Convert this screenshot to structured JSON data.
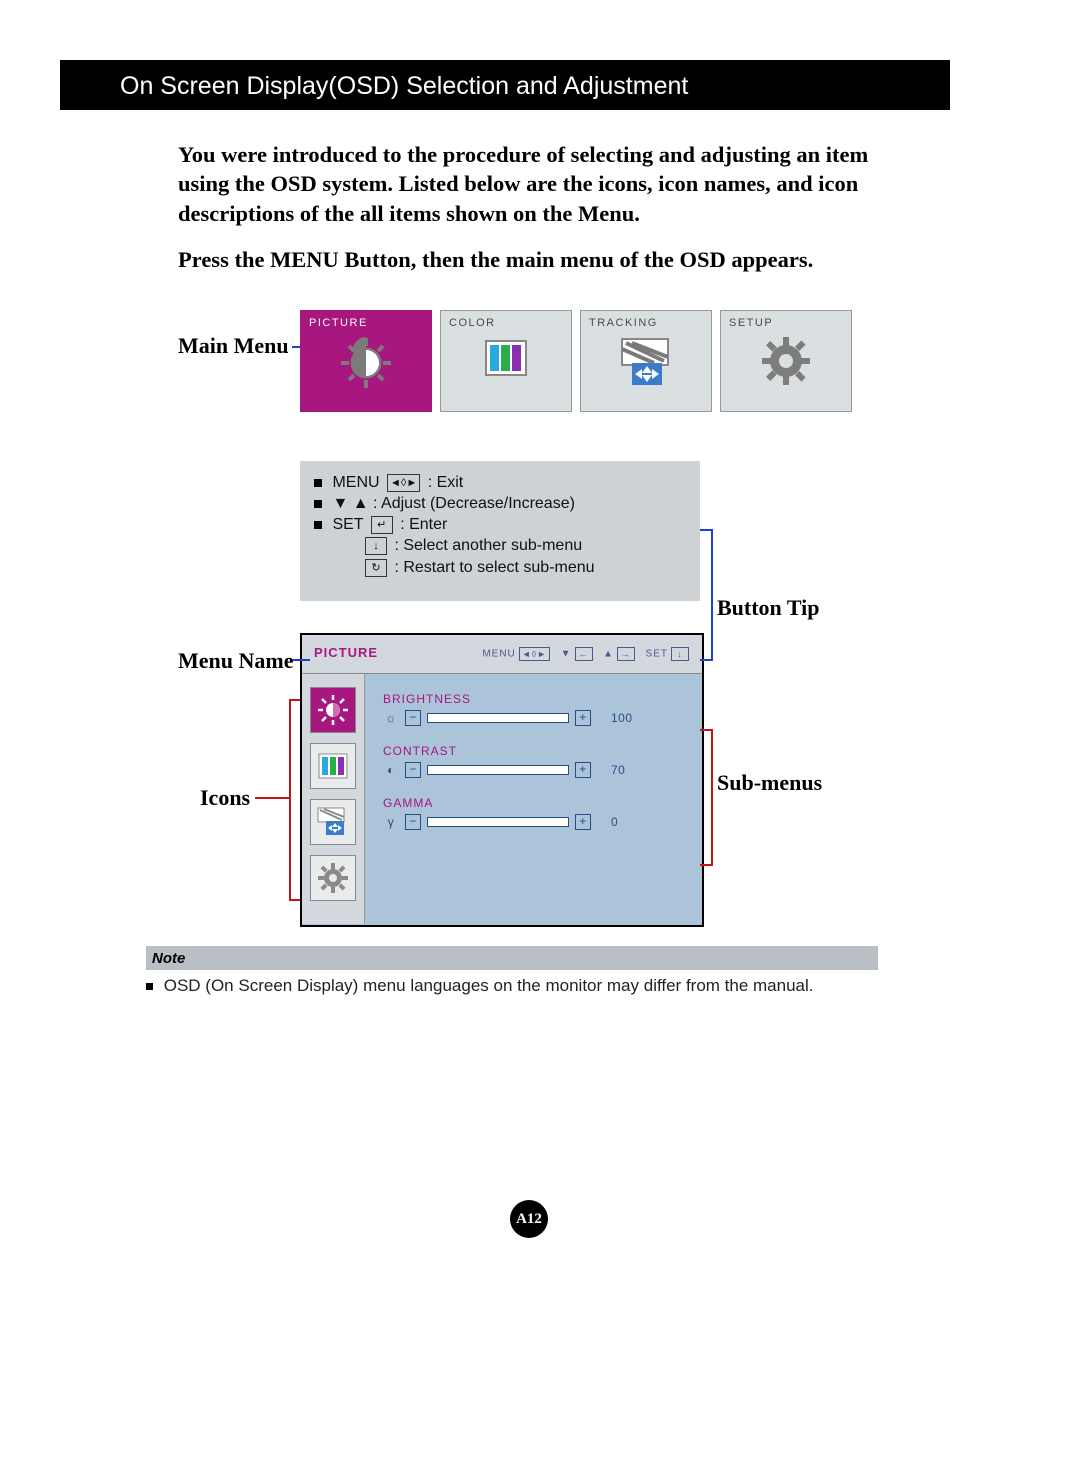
{
  "header": {
    "title": "On Screen Display(OSD) Selection and Adjustment"
  },
  "intro": "You were introduced to the procedure of selecting and adjusting an item using the OSD system.  Listed below are the icons, icon names, and icon descriptions of the all items shown on the Menu.",
  "press": "Press the MENU Button, then the main menu of the OSD appears.",
  "labels": {
    "main_menu": "Main Menu",
    "menu_name": "Menu Name",
    "icons": "Icons",
    "button_tip": "Button Tip",
    "sub_menus": "Sub-menus"
  },
  "tabs": [
    {
      "title": "PICTURE",
      "active": true,
      "icon": "brightness"
    },
    {
      "title": "COLOR",
      "active": false,
      "icon": "color"
    },
    {
      "title": "TRACKING",
      "active": false,
      "icon": "tracking"
    },
    {
      "title": "SETUP",
      "active": false,
      "icon": "gear"
    }
  ],
  "tips": {
    "menu_word": "MENU",
    "menu_key": "◄◊►",
    "menu_text": ": Exit",
    "adjust_text": ": Adjust (Decrease/Increase)",
    "set_word": "SET",
    "set_key": "↵",
    "set_text": ": Enter",
    "down_key": "↓",
    "down_text": ": Select another sub-menu",
    "cycle_key": "↻",
    "cycle_text": ": Restart to select sub-menu"
  },
  "osd": {
    "menu_name": "PICTURE",
    "hint": {
      "menu": "MENU",
      "set": "SET"
    },
    "icons": [
      {
        "name": "brightness",
        "active": true
      },
      {
        "name": "color",
        "active": false
      },
      {
        "name": "tracking",
        "active": false
      },
      {
        "name": "gear",
        "active": false
      }
    ],
    "subs": [
      {
        "name": "BRIGHTNESS",
        "symbol": "☼",
        "value": "100"
      },
      {
        "name": "CONTRAST",
        "symbol": "◐",
        "value": "70"
      },
      {
        "name": "GAMMA",
        "symbol": "γ",
        "value": "0"
      }
    ]
  },
  "note": {
    "heading": "Note",
    "text": "OSD (On Screen Display) menu languages on the monitor may differ from the manual."
  },
  "page_number": "A12"
}
